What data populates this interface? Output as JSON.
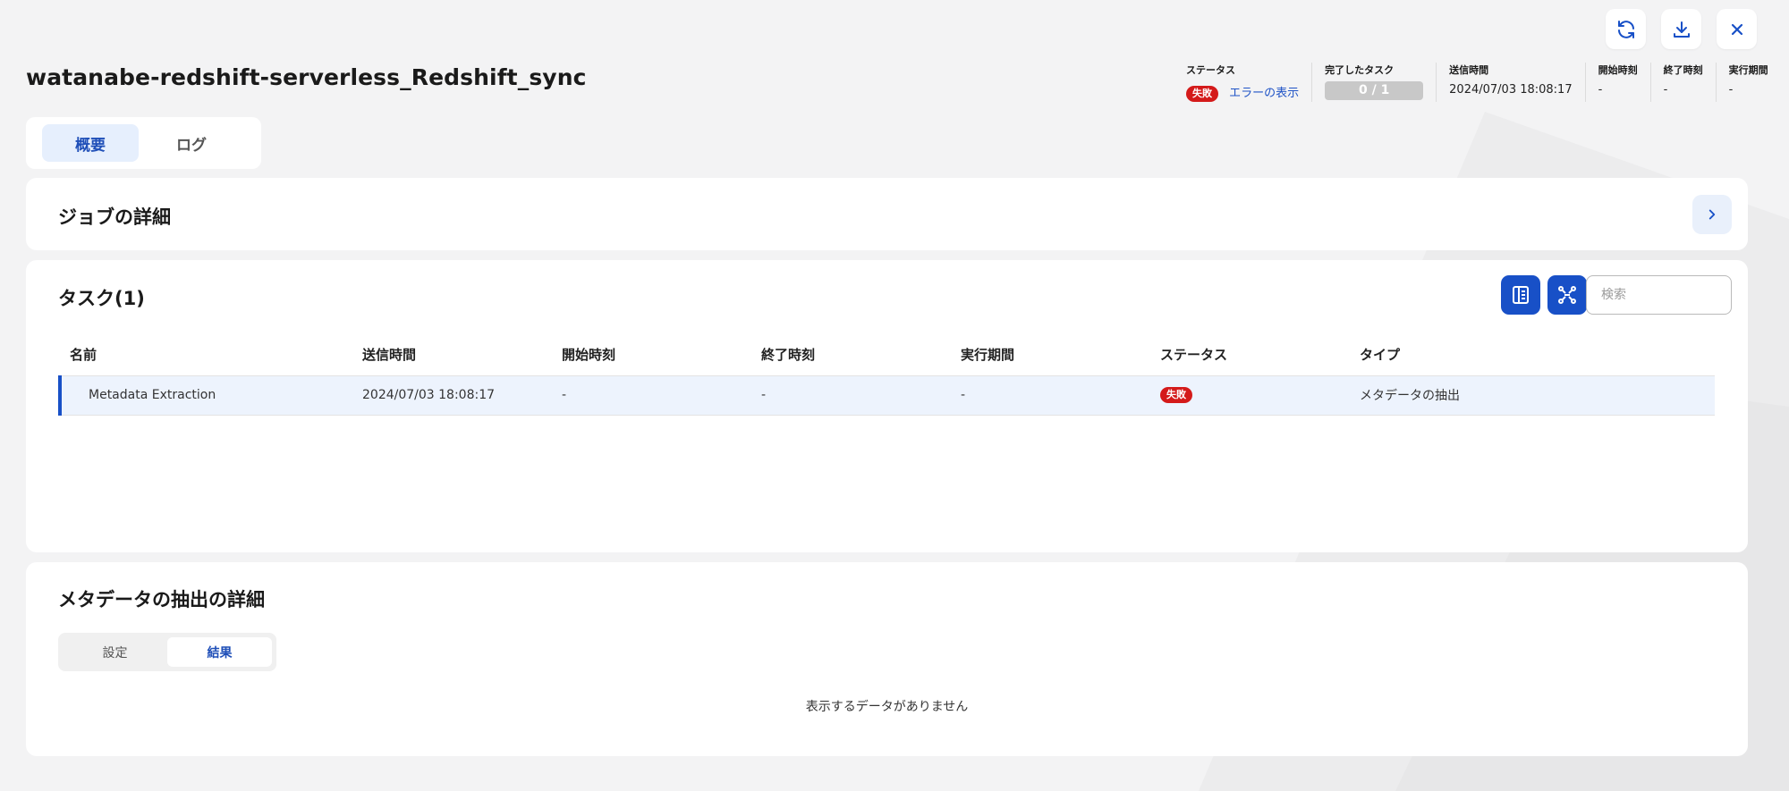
{
  "header": {
    "title": "watanabe-redshift-serverless_Redshift_sync",
    "actions": {
      "refresh_icon": "refresh-icon",
      "download_icon": "download-icon",
      "close_icon": "close-icon"
    }
  },
  "meta": {
    "status_label": "ステータス",
    "status_badge": "失敗",
    "error_link": "エラーの表示",
    "completed_label": "完了したタスク",
    "completed_value": "0 / 1",
    "completed_progress": 0,
    "sent_label": "送信時間",
    "sent_value": "2024/07/03 18:08:17",
    "start_label": "開始時刻",
    "start_value": "-",
    "end_label": "終了時刻",
    "end_value": "-",
    "duration_label": "実行期間",
    "duration_value": "-"
  },
  "tabs": [
    {
      "label": "概要",
      "active": true
    },
    {
      "label": "ログ",
      "active": false
    }
  ],
  "job_details": {
    "title": "ジョブの詳細"
  },
  "tasks": {
    "title": "タスク(1)",
    "search_placeholder": "検索",
    "columns": [
      "名前",
      "送信時間",
      "開始時刻",
      "終了時刻",
      "実行期間",
      "ステータス",
      "タイプ"
    ],
    "rows": [
      {
        "name": "Metadata Extraction",
        "sent": "2024/07/03 18:08:17",
        "start": "-",
        "end": "-",
        "duration": "-",
        "status": "失敗",
        "type": "メタデータの抽出"
      }
    ]
  },
  "extraction_details": {
    "title": "メタデータの抽出の詳細",
    "subtabs": [
      {
        "label": "設定",
        "active": false
      },
      {
        "label": "結果",
        "active": true
      }
    ],
    "empty_message": "表示するデータがありません"
  },
  "colors": {
    "accent": "#1850c7",
    "danger": "#d41a1a",
    "background": "#f3f3f4"
  }
}
